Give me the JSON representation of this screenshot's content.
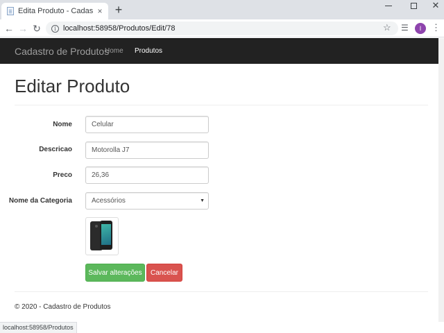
{
  "browser": {
    "tab_title": "Edita Produto - Cadastro de Produtos",
    "tab_close": "×",
    "new_tab": "+",
    "url": "localhost:58958/Produtos/Edit/78",
    "profile_initial": "I",
    "status_url": "localhost:58958/Produtos"
  },
  "nav": {
    "brand": "Cadastro de Produtos",
    "links": [
      "Home",
      "Produtos"
    ],
    "active": "Produtos"
  },
  "page": {
    "heading": "Editar Produto"
  },
  "form": {
    "fields": [
      {
        "label": "Nome",
        "value": "Celular"
      },
      {
        "label": "Descricao",
        "value": "Motorolla J7"
      },
      {
        "label": "Preco",
        "value": "26,36"
      }
    ],
    "category": {
      "label": "Nome da Categoria",
      "selected": "Acessórios"
    },
    "image": {
      "icon": "phone-image"
    },
    "save_label": "Salvar alterações",
    "cancel_label": "Cancelar"
  },
  "footer": {
    "text": "© 2020 - Cadastro de Produtos"
  },
  "colors": {
    "navbar": "#222222",
    "save": "#5cb85c",
    "cancel": "#d9534f",
    "profile": "#8e44ad"
  }
}
